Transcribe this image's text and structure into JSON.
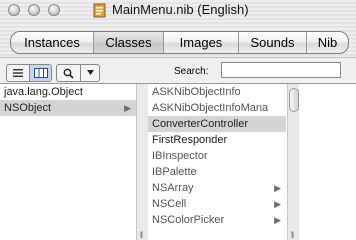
{
  "window": {
    "title": "MainMenu.nib (English)"
  },
  "tabs": [
    {
      "label": "Instances",
      "active": false
    },
    {
      "label": "Classes",
      "active": true
    },
    {
      "label": "Images",
      "active": false
    },
    {
      "label": "Sounds",
      "active": false
    },
    {
      "label": "Nib",
      "active": false
    }
  ],
  "toolbar": {
    "search_label": "Search:",
    "search_value": ""
  },
  "browser": {
    "column1": [
      {
        "label": "java.lang.Object",
        "has_children": false,
        "selected": false
      },
      {
        "label": "NSObject",
        "has_children": true,
        "selected": true
      }
    ],
    "column2": [
      {
        "label": "ASKNibObjectInfo",
        "has_children": false,
        "selected": false
      },
      {
        "label": "ASKNibObjectInfoMana",
        "has_children": false,
        "selected": false
      },
      {
        "label": "ConverterController",
        "has_children": false,
        "selected": true
      },
      {
        "label": "FirstResponder",
        "has_children": false,
        "selected": false
      },
      {
        "label": "IBInspector",
        "has_children": false,
        "selected": false
      },
      {
        "label": "IBPalette",
        "has_children": false,
        "selected": false
      },
      {
        "label": "NSArray",
        "has_children": true,
        "selected": false
      },
      {
        "label": "NSCell",
        "has_children": true,
        "selected": false
      },
      {
        "label": "NSColorPicker",
        "has_children": false,
        "selected": false
      }
    ]
  },
  "colors": {
    "selection": "#d4d4d4",
    "view_selected": "#c9d5e6"
  }
}
